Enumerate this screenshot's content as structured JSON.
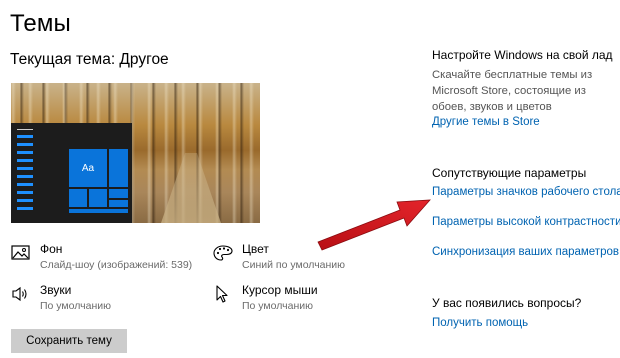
{
  "page": {
    "title": "Темы",
    "current_theme": "Текущая тема: Другое"
  },
  "preview": {
    "tile_label": "Aa"
  },
  "settings": [
    {
      "name": "Фон",
      "value": "Слайд-шоу (изображений: 539)",
      "icon": "picture-icon"
    },
    {
      "name": "Цвет",
      "value": "Синий по умолчанию",
      "icon": "palette-icon"
    },
    {
      "name": "Звуки",
      "value": "По умолчанию",
      "icon": "speaker-icon"
    },
    {
      "name": "Курсор мыши",
      "value": "По умолчанию",
      "icon": "cursor-icon"
    }
  ],
  "save_button": "Сохранить тему",
  "right": {
    "customize_heading": "Настройте Windows на свой лад",
    "customize_desc": "Скачайте бесплатные темы из Microsoft Store, состоящие из обоев, звуков и цветов",
    "store_link": "Другие темы в Store",
    "related_heading": "Сопутствующие параметры",
    "links": [
      "Параметры значков рабочего стола",
      "Параметры высокой контрастности",
      "Синхронизация ваших параметров"
    ],
    "questions_heading": "У вас появились вопросы?",
    "help_link": "Получить помощь"
  },
  "colors": {
    "accent": "#0063b1",
    "tile_blue": "#0a74da",
    "arrow_red": "#d4141b"
  }
}
